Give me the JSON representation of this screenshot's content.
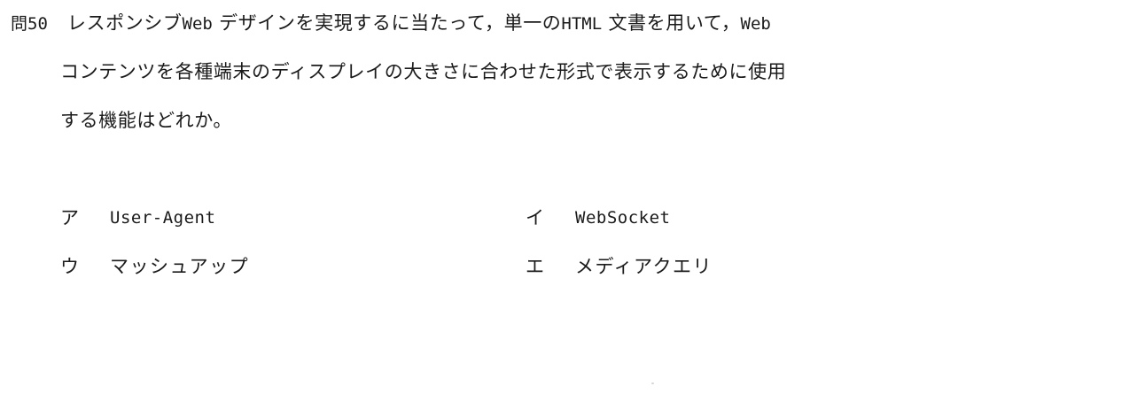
{
  "question": {
    "number": "問50",
    "line1_a": "レスポンシブ",
    "line1_b": "Web",
    "line1_c": "デザインを実現するに当たって，単一の",
    "line1_d": "HTML",
    "line1_e": "文書を用いて，",
    "line1_f": "Web",
    "line2": "コンテンツを各種端末のディスプレイの大きさに合わせた形式で表示するために使用",
    "line3": "する機能はどれか。"
  },
  "choices": [
    {
      "mark": "ア",
      "text": "User-Agent"
    },
    {
      "mark": "イ",
      "text": "WebSocket"
    },
    {
      "mark": "ウ",
      "text": "マッシュアップ"
    },
    {
      "mark": "エ",
      "text": "メディアクエリ"
    }
  ]
}
